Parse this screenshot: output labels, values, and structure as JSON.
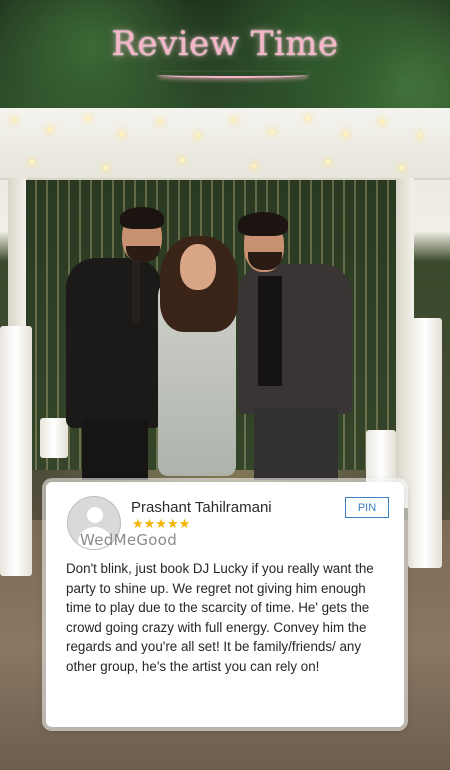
{
  "header": {
    "title": "Review Time"
  },
  "review": {
    "reviewer_name": "Prashant Tahilramani",
    "rating": 5,
    "stars": "★★★★★",
    "watermark": "WedMeGood",
    "pin_label": "PIN",
    "text": "Don't blink, just book DJ Lucky if you really want the party to shine up. We regret not giving him enough time to play due to the scarcity of time. He' gets the crowd going crazy with full energy. Convey him the regards and you're all set! It be family/friends/ any other group, he's the artist you can rely on!"
  },
  "colors": {
    "title": "#f6b6c9",
    "star": "#f0b400",
    "pin_accent": "#3b7fc4"
  },
  "icons": {
    "avatar": "user-avatar-icon",
    "star": "star-icon"
  }
}
